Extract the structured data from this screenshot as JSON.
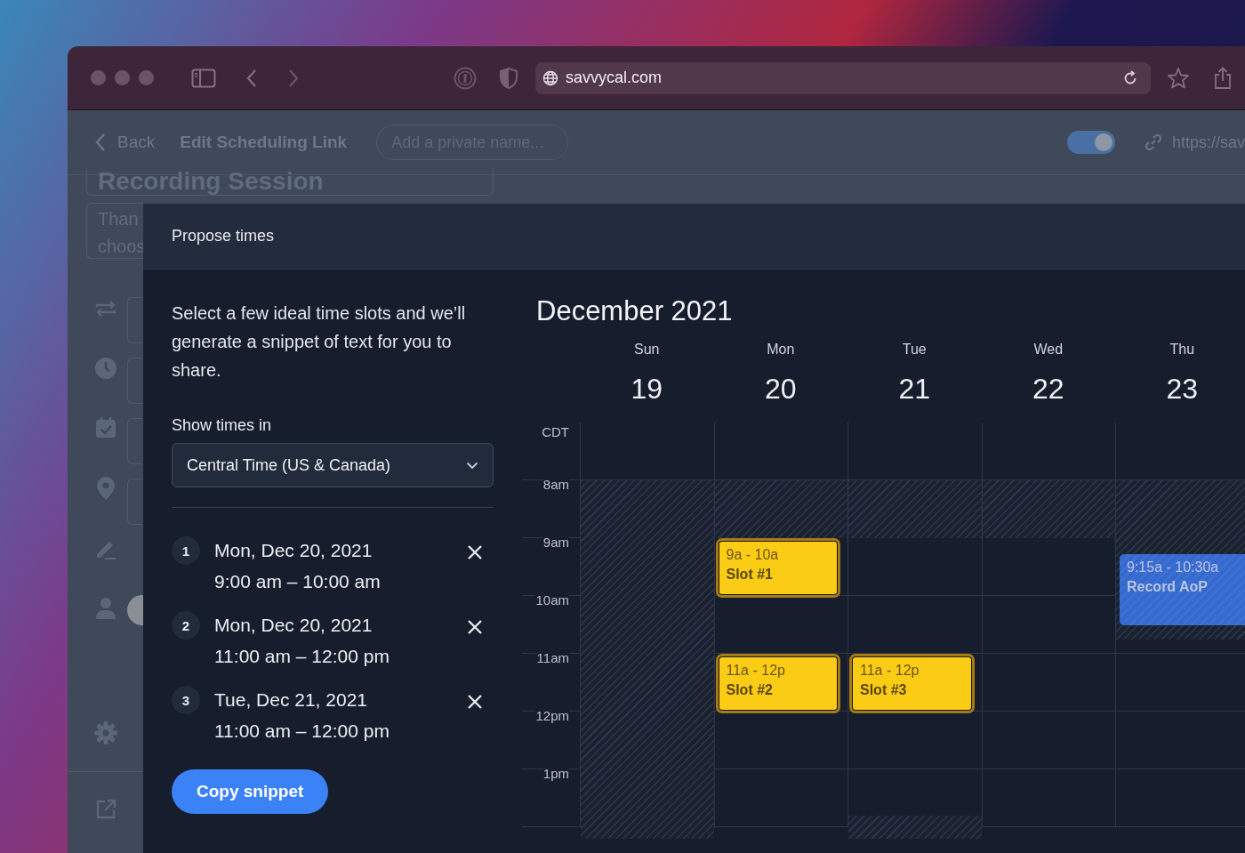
{
  "browser": {
    "url": "savvycal.com"
  },
  "app_bar": {
    "back": "Back",
    "title": "Edit Scheduling Link",
    "name_field": {
      "placeholder": "Add a private name..."
    },
    "toggle": {
      "on": true
    },
    "link": "https://sav"
  },
  "background_form": {
    "title": "Recording Session",
    "message_lines": [
      "Than",
      "choos"
    ]
  },
  "modal": {
    "title": "Propose times",
    "description": "Select a few ideal time slots and we’ll generate a snippet of text for you to share.",
    "timezone_label": "Show times in",
    "timezone": "Central Time (US & Canada)",
    "slots": [
      {
        "number": "1",
        "date": "Mon, Dec 20, 2021",
        "time": "9:00 am – 10:00 am"
      },
      {
        "number": "2",
        "date": "Mon, Dec 20, 2021",
        "time": "11:00 am – 12:00 pm"
      },
      {
        "number": "3",
        "date": "Tue, Dec 21, 2021",
        "time": "11:00 am – 12:00 pm"
      }
    ],
    "copy_button": "Copy snippet"
  },
  "calendar": {
    "month": "December 2021",
    "timezone": "CDT",
    "hours": [
      "8am",
      "9am",
      "10am",
      "11am",
      "12pm",
      "1pm"
    ],
    "days": [
      {
        "name": "Sun",
        "date": "19"
      },
      {
        "name": "Mon",
        "date": "20",
        "events": [
          {
            "kind": "proposed",
            "time": "9a - 10a",
            "title": "Slot #1"
          },
          {
            "kind": "proposed",
            "time": "11a - 12p",
            "title": "Slot #2"
          }
        ]
      },
      {
        "name": "Tue",
        "date": "21",
        "events": [
          {
            "kind": "proposed",
            "time": "11a - 12p",
            "title": "Slot #3"
          }
        ]
      },
      {
        "name": "Wed",
        "date": "22"
      },
      {
        "name": "Thu",
        "date": "23",
        "events": [
          {
            "kind": "booked",
            "time": "9:15a - 10:30a",
            "title": "Record AoP"
          }
        ]
      }
    ]
  }
}
